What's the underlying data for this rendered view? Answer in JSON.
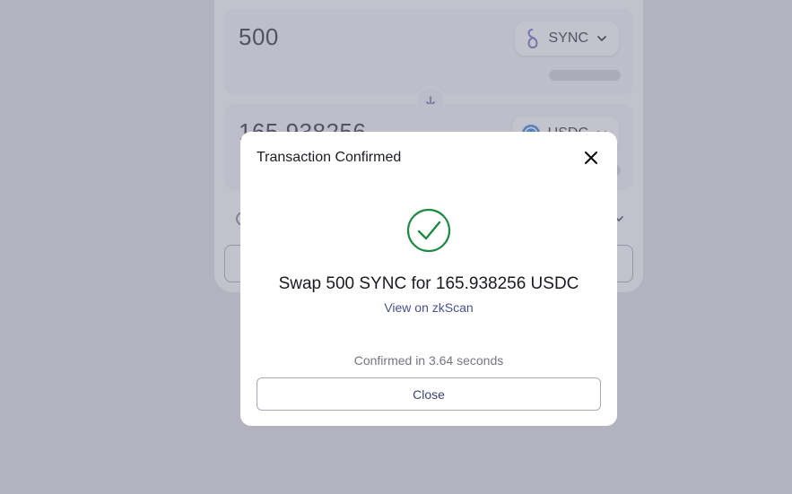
{
  "swap_card": {
    "from": {
      "amount": "500",
      "token_symbol": "SYNC",
      "token_icon": "sync-token-icon"
    },
    "to": {
      "amount": "165.938256",
      "token_symbol": "USDC",
      "token_icon": "usdc-token-icon"
    }
  },
  "modal": {
    "title": "Transaction Confirmed",
    "close_icon": "close-icon",
    "status_icon": "check-circle-icon",
    "summary": "Swap 500 SYNC for 165.938256 USDC",
    "explorer_link": "View on zkScan",
    "confirmation_time": "Confirmed in 3.64 seconds",
    "close_button_label": "Close"
  },
  "colors": {
    "success": "#1f8a44",
    "link": "#4b4f8f",
    "overlay": "#8c8ca0",
    "sync_brand": "#5d5fb4",
    "usdc_brand": "#2775ca"
  }
}
